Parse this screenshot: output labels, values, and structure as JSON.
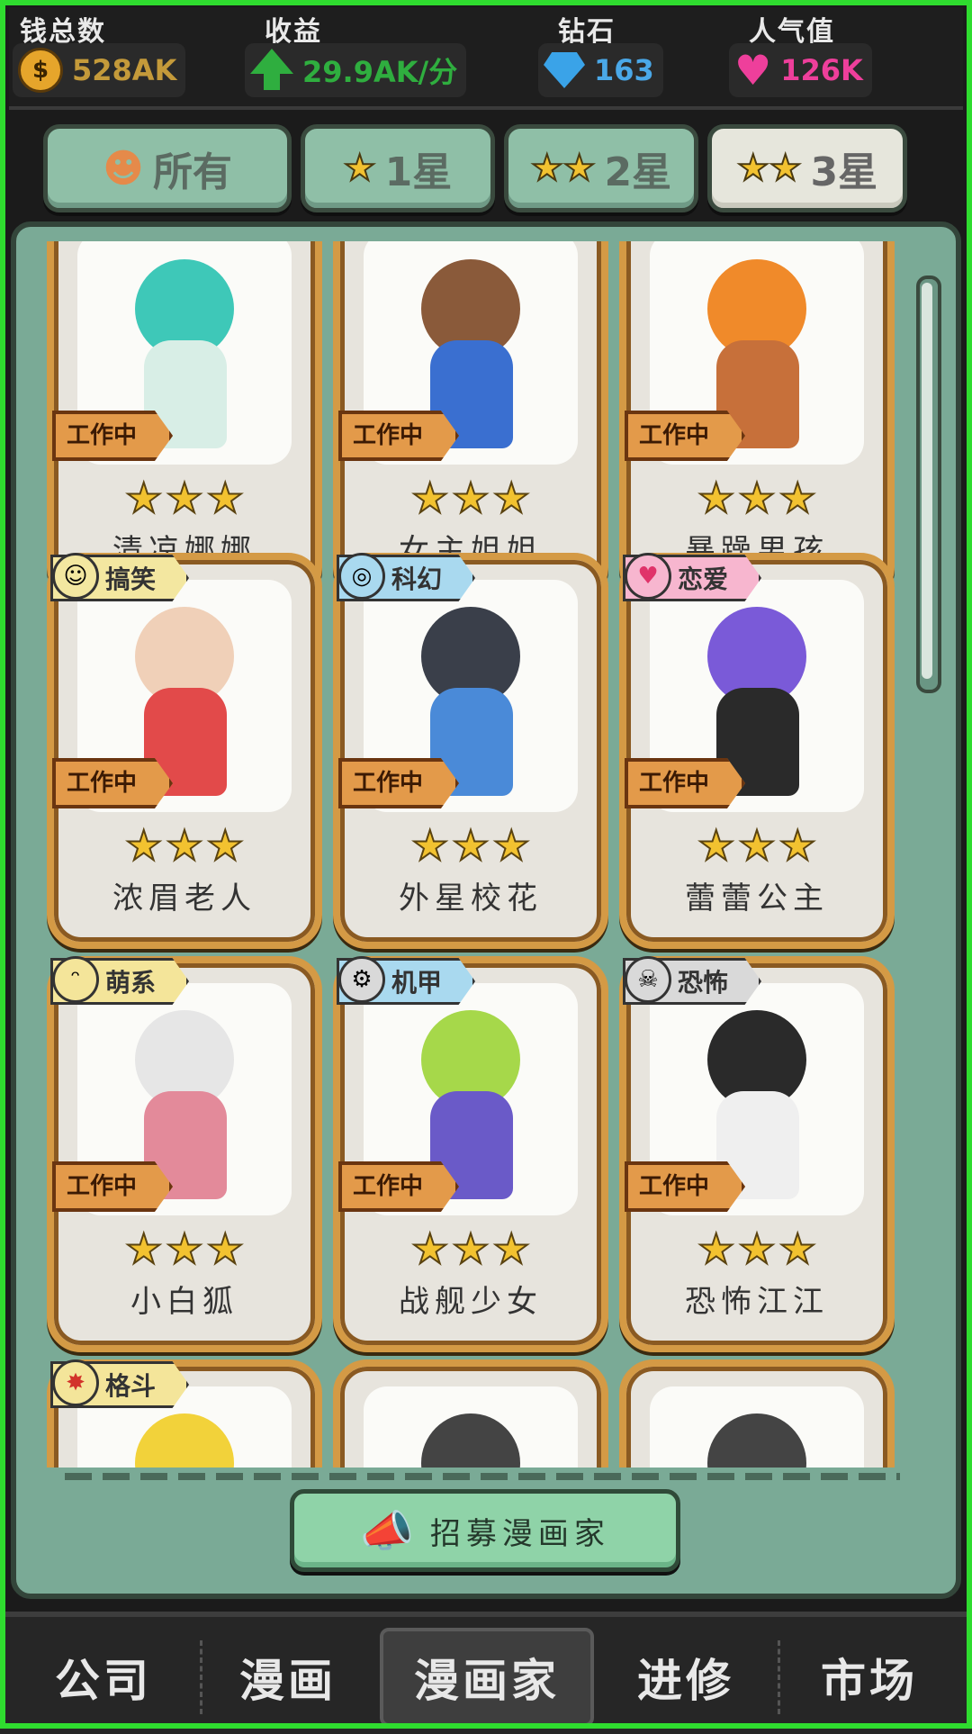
{
  "stats": {
    "money": {
      "label": "钱总数",
      "value": "528AK",
      "icon": "coin-icon",
      "color": "#c49a3a"
    },
    "income": {
      "label": "收益",
      "value": "29.9AK/分",
      "icon": "up-arrow-icon",
      "color": "#2fae3f"
    },
    "diamond": {
      "label": "钻石",
      "value": "163",
      "icon": "diamond-icon",
      "color": "#4aa8e8"
    },
    "popularity": {
      "label": "人气值",
      "value": "126K",
      "icon": "heart-icon",
      "color": "#ee3f9b"
    }
  },
  "filters": [
    {
      "label": "所有",
      "icon": "people-icon",
      "active": false
    },
    {
      "label": "1星",
      "icon": "star-icon",
      "stars": 1,
      "active": false
    },
    {
      "label": "2星",
      "icon": "star-icon",
      "stars": 2,
      "active": false
    },
    {
      "label": "3星",
      "icon": "star-icon",
      "stars": 3,
      "active": true
    }
  ],
  "status_label": "工作中",
  "cards": [
    {
      "name": "清凉娜娜",
      "stars": 3,
      "status": "工作中",
      "tag": ""
    },
    {
      "name": "女主姐姐",
      "stars": 3,
      "status": "工作中",
      "tag": ""
    },
    {
      "name": "暴躁男孩",
      "stars": 3,
      "status": "工作中",
      "tag": ""
    },
    {
      "name": "浓眉老人",
      "stars": 3,
      "status": "工作中",
      "tag": "搞笑",
      "tag_color": "#f3e7a0"
    },
    {
      "name": "外星校花",
      "stars": 3,
      "status": "工作中",
      "tag": "科幻",
      "tag_color": "#a9d9ef"
    },
    {
      "name": "蕾蕾公主",
      "stars": 3,
      "status": "工作中",
      "tag": "恋爱",
      "tag_color": "#f7b6cf"
    },
    {
      "name": "小白狐",
      "stars": 3,
      "status": "工作中",
      "tag": "萌系",
      "tag_color": "#f4e59a"
    },
    {
      "name": "战舰少女",
      "stars": 3,
      "status": "工作中",
      "tag": "机甲",
      "tag_color": "#a9d9ef"
    },
    {
      "name": "恐怖江江",
      "stars": 3,
      "status": "工作中",
      "tag": "恐怖",
      "tag_color": "#d9d9d9"
    },
    {
      "name": "",
      "stars": 0,
      "status": "",
      "tag": "格斗",
      "tag_color": "#f4e59a"
    },
    {
      "name": "",
      "stars": 0,
      "status": "",
      "tag": "",
      "locked": true
    },
    {
      "name": "",
      "stars": 0,
      "status": "",
      "tag": "",
      "locked": true
    }
  ],
  "recruit_button": "招募漫画家",
  "nav": [
    {
      "label": "公司",
      "active": false
    },
    {
      "label": "漫画",
      "active": false
    },
    {
      "label": "漫画家",
      "active": true
    },
    {
      "label": "进修",
      "active": false
    },
    {
      "label": "市场",
      "active": false
    }
  ]
}
